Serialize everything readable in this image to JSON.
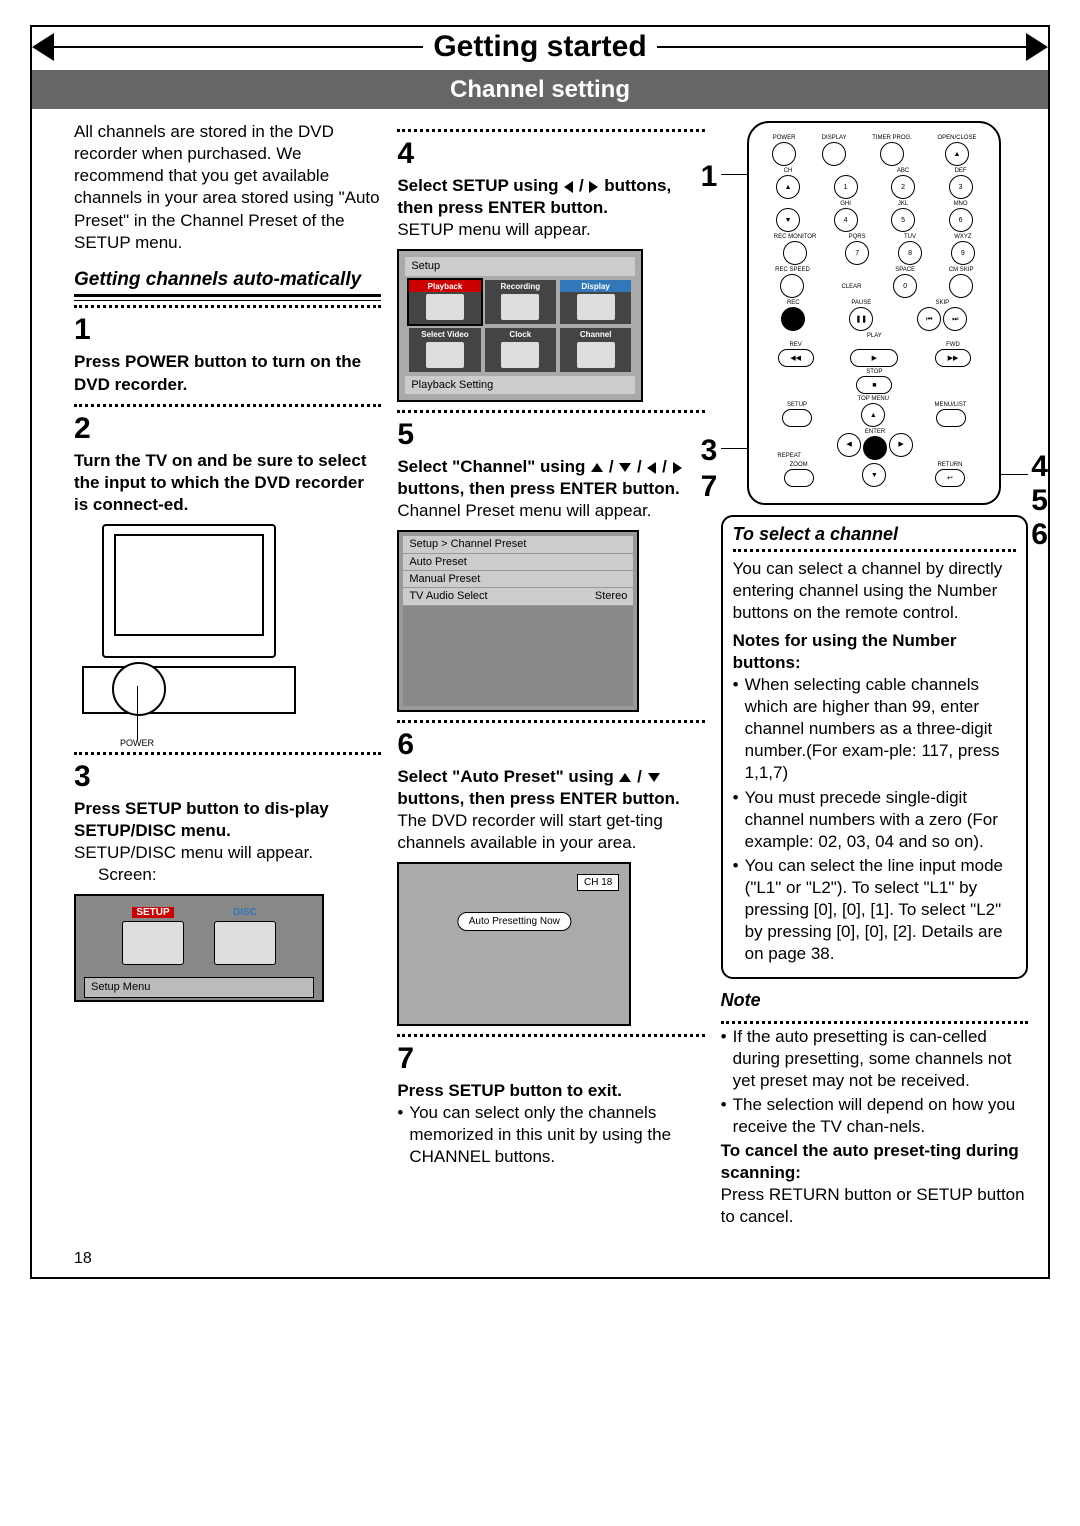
{
  "chapter_title": "Getting started",
  "section_bar": "Channel setting",
  "page_number": "18",
  "intro": "All channels are stored in the DVD recorder when purchased. We recommend that you get available channels in your area stored using \"Auto Preset\" in the Channel Preset of the SETUP menu.",
  "subhead_auto": "Getting channels auto-matically",
  "steps": {
    "s1": {
      "num": "1",
      "bold": "Press POWER button to turn on the DVD recorder."
    },
    "s2": {
      "num": "2",
      "bold": "Turn the TV on and be sure to select the input to which the DVD recorder is connect-ed."
    },
    "s3": {
      "num": "3",
      "bold": "Press SETUP button to dis-play SETUP/DISC menu.",
      "body": "SETUP/DISC menu will appear.",
      "indent": "Screen:"
    },
    "s4": {
      "num": "4",
      "bold_pre": "Select SETUP using ",
      "bold_post": " buttons, then press ENTER button.",
      "body": "SETUP menu will appear."
    },
    "s5": {
      "num": "5",
      "bold_pre": "Select \"Channel\" using ",
      "bold_post": " buttons, then press ENTER button.",
      "body": "Channel Preset menu will appear."
    },
    "s6": {
      "num": "6",
      "bold_pre": "Select \"Auto Preset\" using ",
      "bold_post": " buttons, then press ENTER button.",
      "body": "The DVD recorder will start get-ting channels available in your area."
    },
    "s7": {
      "num": "7",
      "bold": "Press SETUP button to exit.",
      "bullet": "You can select only the channels memorized in this unit by using the CHANNEL buttons."
    }
  },
  "setup_screen": {
    "title": "Setup",
    "tiles": [
      "Playback",
      "Recording",
      "Display",
      "Select Video",
      "Clock",
      "Channel"
    ],
    "footer": "Playback Setting"
  },
  "preset_menu": {
    "breadcrumb": "Setup > Channel Preset",
    "rows": [
      {
        "l": "Auto Preset",
        "r": ""
      },
      {
        "l": "Manual Preset",
        "r": ""
      },
      {
        "l": "TV Audio Select",
        "r": "Stereo"
      }
    ]
  },
  "auto_screen": {
    "ch": "CH 18",
    "msg": "Auto Presetting Now"
  },
  "sd_screen": {
    "a": "SETUP",
    "b": "DISC",
    "footer": "Setup Menu"
  },
  "tv_diagram": {
    "power": "POWER"
  },
  "select_box": {
    "title": "To select a channel",
    "intro": "You can select a channel by directly entering channel using the Number buttons on the remote control.",
    "notes_head": "Notes for using the Number buttons:",
    "bullets": [
      "When selecting cable channels which are higher than 99, enter channel numbers as a three-digit number.(For exam-ple: 117, press 1,1,7)",
      "You must precede single-digit channel numbers with a zero (For example: 02, 03, 04 and so on).",
      "You can select the line input mode (\"L1\" or \"L2\"). To select \"L1\" by pressing [0], [0], [1]. To select \"L2\" by pressing [0], [0], [2]. Details are on page 38."
    ]
  },
  "note_box": {
    "title": "Note",
    "bullets": [
      "If the auto presetting is can-celled during presetting, some channels not yet preset may not be received.",
      "The selection will depend on how you receive the TV chan-nels."
    ],
    "cancel_head": "To cancel the auto preset-ting during scanning:",
    "cancel_body": "Press RETURN button or SETUP button to cancel."
  },
  "remote": {
    "row1": [
      "POWER",
      "DISPLAY",
      "TIMER PROG.",
      "OPEN/CLOSE"
    ],
    "numlabels_top": [
      "",
      "ABC",
      "DEF"
    ],
    "nums_top": [
      "1",
      "2",
      "3"
    ],
    "numlabels_mid": [
      "GHI",
      "JKL",
      "MNO"
    ],
    "nums_mid": [
      "4",
      "5",
      "6"
    ],
    "numlabels_bot": [
      "PQRS",
      "TUV",
      "WXYZ"
    ],
    "nums_bot": [
      "7",
      "8",
      "9"
    ],
    "row_zero_labels": [
      "REC SPEED",
      "CLEAR",
      "SPACE",
      "CM SKIP"
    ],
    "zero": "0",
    "skip_row": [
      "REC",
      "PAUSE",
      "SKIP"
    ],
    "play": "PLAY",
    "rev": "REV",
    "fwd": "FWD",
    "stop": "STOP",
    "setup": "SETUP",
    "topmenu": "TOP MENU",
    "menulist": "MENU/LIST",
    "repeat": "REPEAT",
    "enter": "ENTER",
    "zoom": "ZOOM",
    "return": "RETURN",
    "ch": "CH",
    "rec_monitor": "REC MONITOR"
  },
  "callouts": {
    "c1": "1",
    "c3": "3",
    "c4": "4",
    "c5": "5",
    "c6": "6",
    "c7": "7"
  }
}
